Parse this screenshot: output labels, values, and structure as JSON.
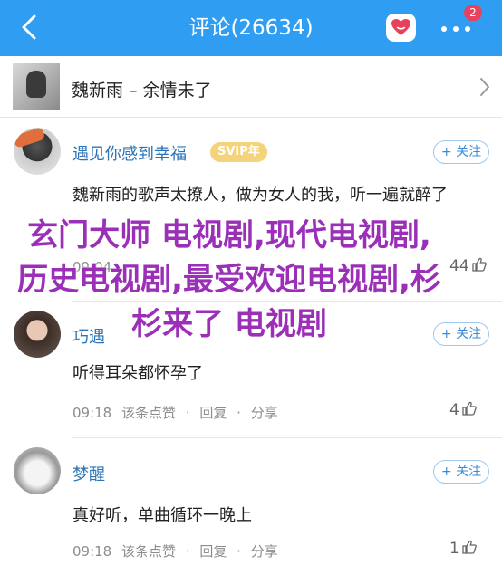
{
  "header": {
    "title": "评论(26634)",
    "badge_count": "2"
  },
  "song": {
    "title": "魏新雨 – 余情未了"
  },
  "comments": [
    {
      "username": "遇见你感到幸福",
      "vip": "SVIP年",
      "follow": "+ 关注",
      "text": "魏新雨的歌声太撩人，做为女人的我，听一遍就醉了",
      "time": "09:04",
      "likes": "44"
    },
    {
      "username": "巧遇",
      "follow": "+ 关注",
      "text": "听得耳朵都怀孕了",
      "time": "09:18",
      "action_like": "该条点赞",
      "action_reply": "回复",
      "action_share": "分享",
      "likes": "4"
    },
    {
      "username": "梦醒",
      "follow": "+ 关注",
      "text": "真好听，单曲循环一晚上",
      "time": "09:18",
      "action_like": "该条点赞",
      "action_reply": "回复",
      "action_share": "分享",
      "likes": "1"
    }
  ],
  "watermark": {
    "text": "玄门大师 电视剧,现代电视剧,历史电视剧,最受欢迎电视剧,杉杉来了 电视剧"
  },
  "colors": {
    "header_bg": "#2f9ef2",
    "username": "#2b74b8",
    "watermark": "#9b2fb8",
    "badge": "#e8415b"
  }
}
